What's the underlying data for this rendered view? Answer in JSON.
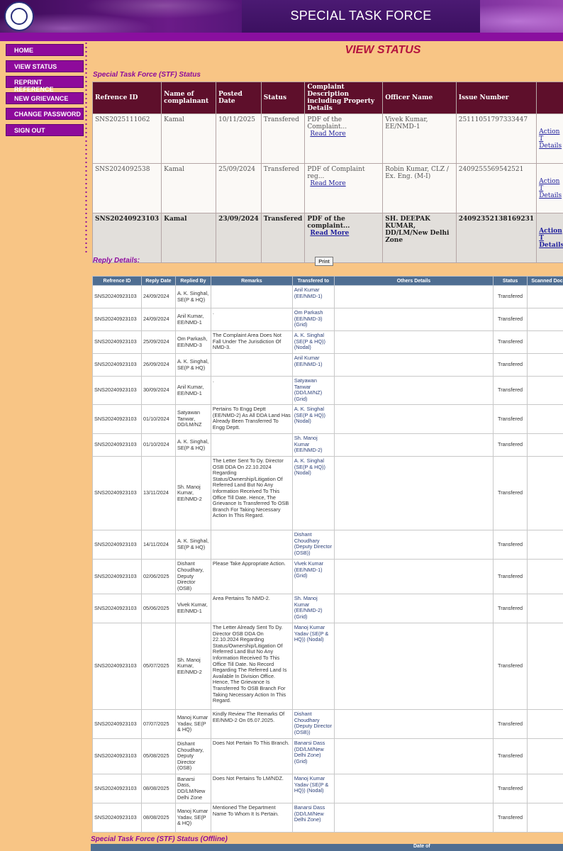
{
  "header": {
    "title": "SPECIAL TASK FORCE"
  },
  "sidebar": {
    "items": [
      "HOME",
      "VIEW STATUS",
      "REPRINT REFERENCE",
      "NEW GRIEVANCE",
      "CHANGE PASSWORD",
      "SIGN OUT"
    ]
  },
  "page": {
    "heading": "VIEW STATUS"
  },
  "stf": {
    "title": "Special Task Force (STF) Status",
    "headers": [
      "Refrence ID",
      "Name of complainant",
      "Posted Date",
      "Status",
      "Complaint Description including Property Details",
      "Officer Name",
      "Issue Number",
      ""
    ],
    "read_more": "Read More",
    "action": "Action T",
    "details": "Details",
    "rows": [
      {
        "id": "SNS2025111062",
        "name": "Kamal",
        "date": "10/11/2025",
        "status": "Transfered",
        "desc": "PDF of the Complaint...",
        "officer": "Vivek Kumar, EE/NMD-1",
        "issue": "25111051797333447"
      },
      {
        "id": "SNS2024092538",
        "name": "Kamal",
        "date": "25/09/2024",
        "status": "Transfered",
        "desc": "PDF of Complaint reg...",
        "officer": "Robin Kumar, CLZ / Ex. Eng. (M-I)",
        "issue": "2409255569542521"
      },
      {
        "id": "SNS20240923103",
        "name": "Kamal",
        "date": "23/09/2024",
        "status": "Transfered",
        "desc": "PDF of the complaint...",
        "officer": "SH. DEEPAK KUMAR, DD/LM/New Delhi Zone",
        "issue": "24092352138169231"
      }
    ]
  },
  "reply": {
    "title": "Reply Details:",
    "print_label": "Print",
    "headers": [
      "Refrence ID",
      "Reply Date",
      "Replied By",
      "Remarks",
      "Transfered to",
      "Others Details",
      "Status",
      "Scanned Doc"
    ],
    "rows": [
      {
        "id": "SNS20240923103",
        "date": "24/09/2024",
        "by": "A. K. Singhal, SE(P & HQ)",
        "remarks": "",
        "to": "Anil Kumar (EE/NMD-1)",
        "status": "Transfered"
      },
      {
        "id": "SNS20240923103",
        "date": "24/09/2024",
        "by": "Anil Kumar, EE/NMD-1",
        "remarks": ".",
        "to": "Om Parkash (EE/NMD-3) (Grid)",
        "status": "Transfered"
      },
      {
        "id": "SNS20240923103",
        "date": "25/09/2024",
        "by": "Om Parkash, EE/NMD-3",
        "remarks": "The Complaint Area Does Not Fall Under The Jurisdiction Of NMD-3.",
        "to": "A. K. Singhal (SE(P & HQ)) (Nodal)",
        "status": "Transfered"
      },
      {
        "id": "SNS20240923103",
        "date": "26/09/2024",
        "by": "A. K. Singhal, SE(P & HQ)",
        "remarks": "",
        "to": "Anil Kumar (EE/NMD-1)",
        "status": "Transfered"
      },
      {
        "id": "SNS20240923103",
        "date": "30/09/2024",
        "by": "Anil Kumar, EE/NMD-1",
        "remarks": ".",
        "to": "Satyawan Tanwar (DD/LM/NZ) (Grid)",
        "status": "Transfered"
      },
      {
        "id": "SNS20240923103",
        "date": "01/10/2024",
        "by": "Satyawan Tanwar, DD/LM/NZ",
        "remarks": "Pertains To Engg Deptt (EE/NMD-2) As All DDA Land Has Already Been Transferred To Engg Deptt.",
        "to": "A. K. Singhal (SE(P & HQ)) (Nodal)",
        "status": "Transfered"
      },
      {
        "id": "SNS20240923103",
        "date": "01/10/2024",
        "by": "A. K. Singhal, SE(P & HQ)",
        "remarks": "",
        "to": "Sh. Manoj Kumar (EE/NMD-2)",
        "status": "Transfered"
      },
      {
        "id": "SNS20240923103",
        "date": "13/11/2024",
        "by": "Sh. Manoj Kumar, EE/NMD-2",
        "remarks": "The Letter Sent To Dy. Director OSB DDA On 22.10.2024 Regarding Status/Ownership/Litigation Of Referred Land But No Any Information Received To This Office Till Date. Hence, The Grievance Is Transferred To OSB Branch For Taking Necessary Action In This Regard.",
        "to": "A. K. Singhal (SE(P & HQ)) (Nodal)",
        "status": "Transfered"
      },
      {
        "id": "SNS20240923103",
        "date": "14/11/2024",
        "by": "A. K. Singhal, SE(P & HQ)",
        "remarks": "",
        "to": "Dishant Choudhary (Deputy Director (OSB))",
        "status": "Transfered"
      },
      {
        "id": "SNS20240923103",
        "date": "02/06/2025",
        "by": "Dishant Choudhary, Deputy Director (OSB)",
        "remarks": "Please Take Appropriate Action.",
        "to": "Vivek Kumar (EE/NMD-1) (Grid)",
        "status": "Transfered"
      },
      {
        "id": "SNS20240923103",
        "date": "05/06/2025",
        "by": "Vivek Kumar, EE/NMD-1",
        "remarks": "Area Pertains To NMD-2.",
        "to": "Sh. Manoj Kumar (EE/NMD-2) (Grid)",
        "status": "Transfered"
      },
      {
        "id": "SNS20240923103",
        "date": "05/07/2025",
        "by": "Sh. Manoj Kumar, EE/NMD-2",
        "remarks": "The Letter Already Sent To Dy. Director OSB DDA On 22.10.2024 Regarding Status/Ownership/Litigation Of Referred Land But No Any Information Received To This Office Till Date. No Record Regarding The Referred Land Is Available In Division Office. Hence, The Grievance Is Transferred To OSB Branch For Taking Necessary Action In This Regard.",
        "to": "Manoj Kumar Yadav (SE(P & HQ)) (Nodal)",
        "status": "Transfered"
      },
      {
        "id": "SNS20240923103",
        "date": "07/07/2025",
        "by": "Manoj Kumar Yadav, SE(P & HQ)",
        "remarks": "Kindly Review The Remarks Of EE/NMD-2 On 05.07.2025.",
        "to": "Dishant Choudhary (Deputy Director (OSB))",
        "status": "Transfered"
      },
      {
        "id": "SNS20240923103",
        "date": "05/08/2025",
        "by": "Dishant Choudhary, Deputy Director (OSB)",
        "remarks": "Does Not Pertain To This Branch.",
        "to": "Banarsi Dass (DD/LM/New Delhi Zone) (Grid)",
        "status": "Transfered"
      },
      {
        "id": "SNS20240923103",
        "date": "08/08/2025",
        "by": "Banarsi Dass, DD/LM/New Delhi Zone",
        "remarks": "Does Not Pertains To LM/NDZ.",
        "to": "Manoj Kumar Yadav (SE(P & HQ)) (Nodal)",
        "status": "Transfered"
      },
      {
        "id": "SNS20240923103",
        "date": "08/08/2025",
        "by": "Manoj Kumar Yadav, SE(P & HQ)",
        "remarks": "Mentioned The Department Name To Whom It Is Pertain.",
        "to": "Banarsi Dass (DD/LM/New Delhi Zone)",
        "status": "Transfered"
      }
    ]
  },
  "offline": {
    "title": "Special Task Force (STF) Status (Offline)",
    "header_fragment": "Date of"
  }
}
